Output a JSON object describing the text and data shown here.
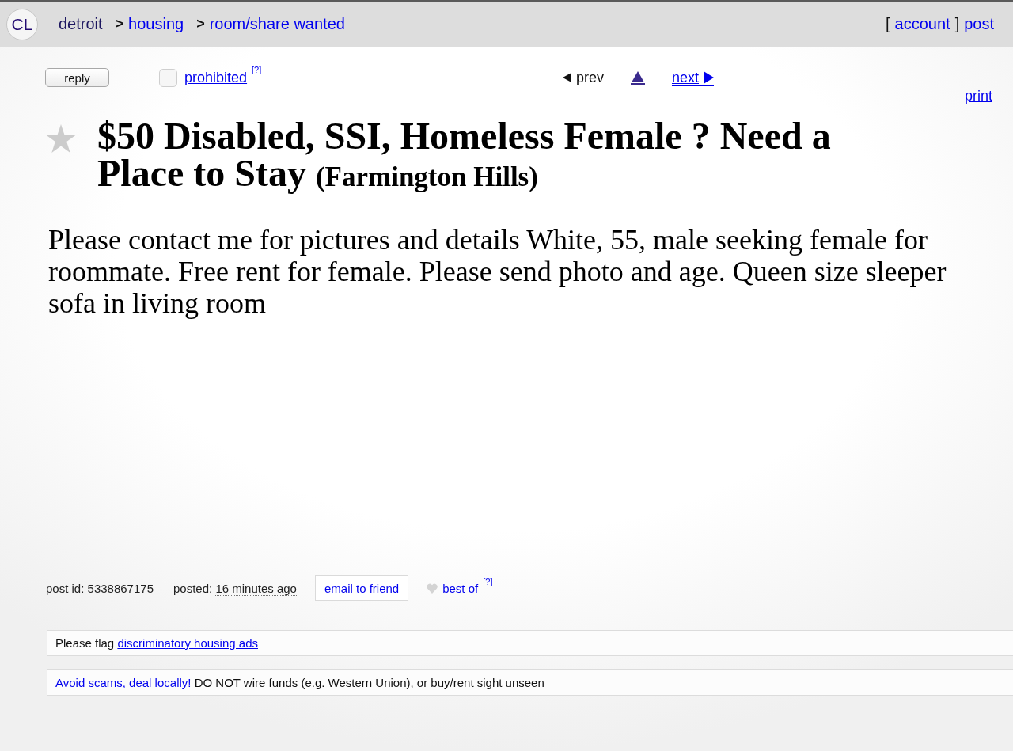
{
  "header": {
    "logo": "CL",
    "breadcrumbs": [
      {
        "label": "detroit",
        "kind": "site"
      },
      {
        "separator": ">",
        "label": "housing",
        "kind": "category"
      },
      {
        "separator": ">",
        "label": "room/share wanted",
        "kind": "category"
      }
    ],
    "user_links": {
      "open_bracket": "[",
      "account": "account",
      "close_bracket": "]",
      "post": "post"
    }
  },
  "toolbar": {
    "reply_button": "reply",
    "prohibited": {
      "checked": false,
      "label": "prohibited",
      "help": "[?]"
    },
    "nav": {
      "prev": {
        "label": "prev",
        "disabled": true
      },
      "next": {
        "label": "next",
        "disabled": false
      }
    },
    "print": "print"
  },
  "title": {
    "starred": false,
    "text": "$50 Disabled, SSI, Homeless Female ? Need a Place to Stay",
    "location": "(Farmington Hills)"
  },
  "body": "Please contact me for pictures and details White, 55, male seeking female for roommate. Free rent for female. Please send photo and age. Queen size sleeper sofa in living room",
  "post_info": {
    "post_id": {
      "label": "post id:",
      "value": "5338867175"
    },
    "posted": {
      "label": "posted:",
      "value": "16 minutes ago"
    },
    "email_button": "email to friend",
    "best_of": {
      "liked": false,
      "label": "best of",
      "help": "[?]"
    }
  },
  "notices": [
    {
      "parts": [
        {
          "kind": "text",
          "text": "Please flag"
        },
        {
          "kind": "link",
          "text": "discriminatory housing ads"
        }
      ]
    },
    {
      "parts": [
        {
          "kind": "link",
          "text": "Avoid scams, deal locally!"
        },
        {
          "kind": "text",
          "text": "DO NOT wire funds (e.g. Western Union), or buy/rent sight unseen"
        }
      ]
    }
  ]
}
